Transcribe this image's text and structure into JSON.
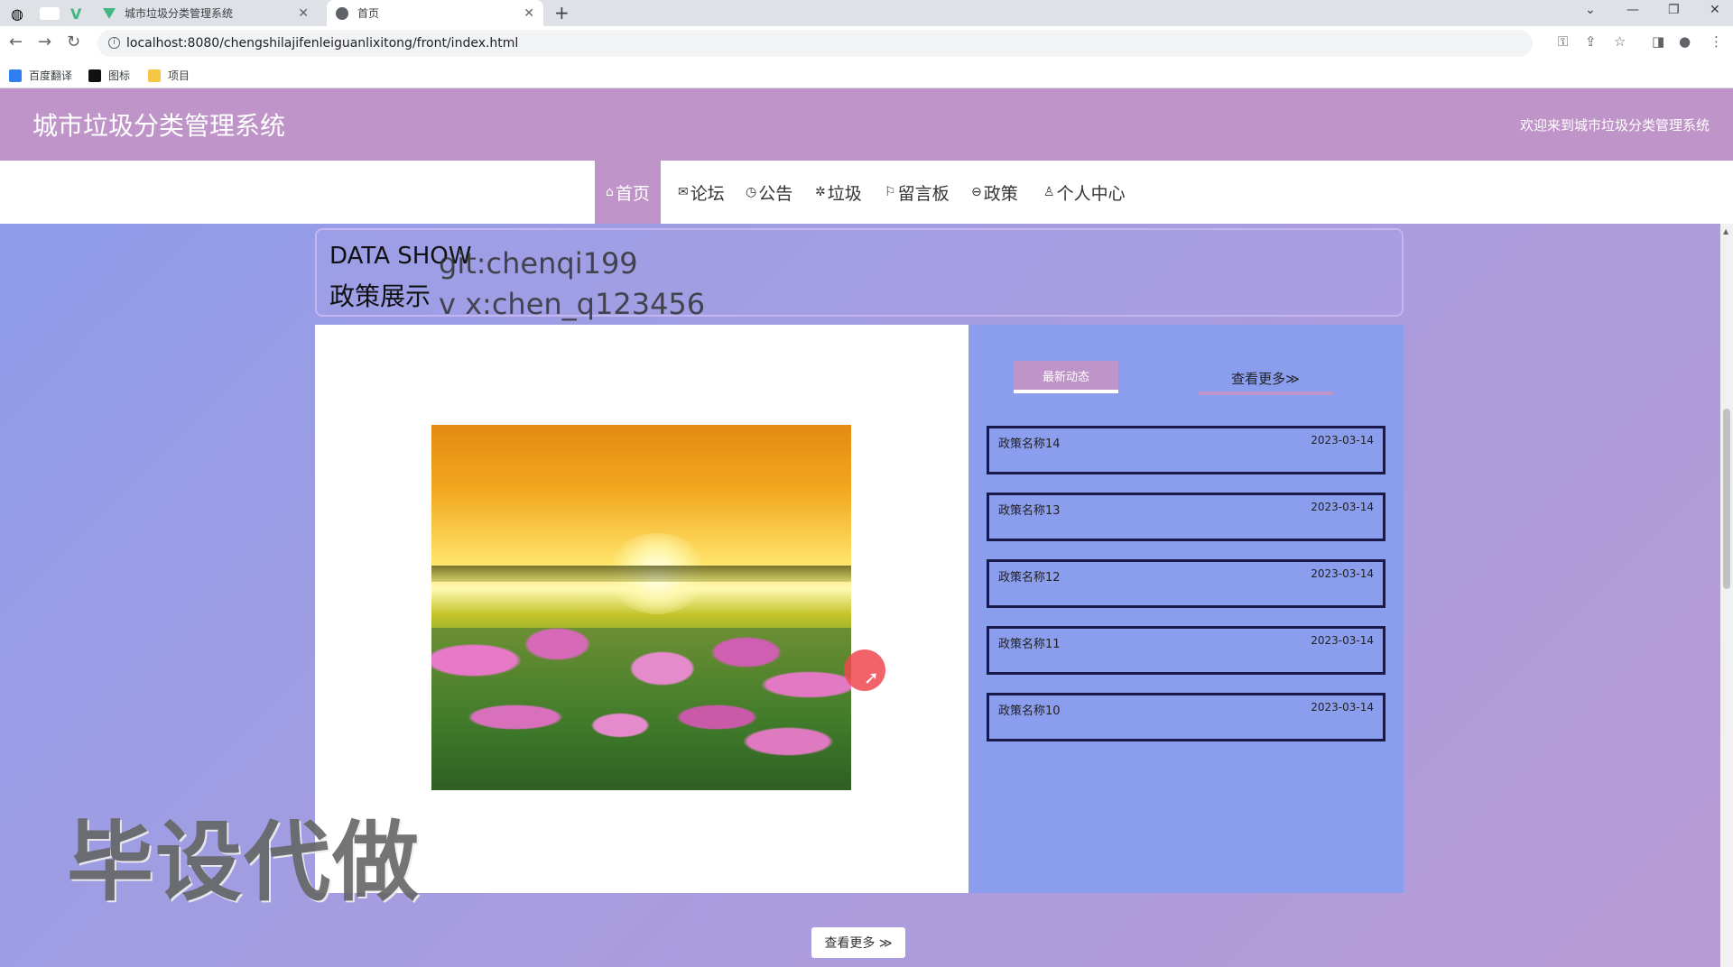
{
  "browser": {
    "tabs": [
      {
        "label": "城市垃圾分类管理系统",
        "active": false
      },
      {
        "label": "首页",
        "active": true
      }
    ],
    "url": "localhost:8080/chengshilajifenleiguanlixitong/front/index.html",
    "bookmarks": [
      "百度翻译",
      "图标",
      "项目"
    ]
  },
  "header": {
    "title": "城市垃圾分类管理系统",
    "welcome": "欢迎来到城市垃圾分类管理系统"
  },
  "nav": {
    "items": [
      {
        "icon": "⌂",
        "label": "首页"
      },
      {
        "icon": "✉",
        "label": "论坛"
      },
      {
        "icon": "◷",
        "label": "公告"
      },
      {
        "icon": "✲",
        "label": "垃圾"
      },
      {
        "icon": "⚐",
        "label": "留言板"
      },
      {
        "icon": "⊖",
        "label": "政策"
      },
      {
        "icon": "♙",
        "label": "个人中心"
      }
    ]
  },
  "section": {
    "en": "DATA SHOW",
    "cn": "政策展示"
  },
  "watermark": {
    "line1": "git:chenqi199",
    "line2": "v x:chen_q123456",
    "big": "毕设代做"
  },
  "news": {
    "tab_label": "最新动态",
    "more_label": "查看更多≫",
    "items": [
      {
        "name": "政策名称14",
        "date": "2023-03-14"
      },
      {
        "name": "政策名称13",
        "date": "2023-03-14"
      },
      {
        "name": "政策名称12",
        "date": "2023-03-14"
      },
      {
        "name": "政策名称11",
        "date": "2023-03-14"
      },
      {
        "name": "政策名称10",
        "date": "2023-03-14"
      }
    ]
  },
  "bottom": {
    "more_label": "查看更多 ≫"
  },
  "colors": {
    "header": "#bf94c8",
    "panel": "#8b9ded"
  }
}
